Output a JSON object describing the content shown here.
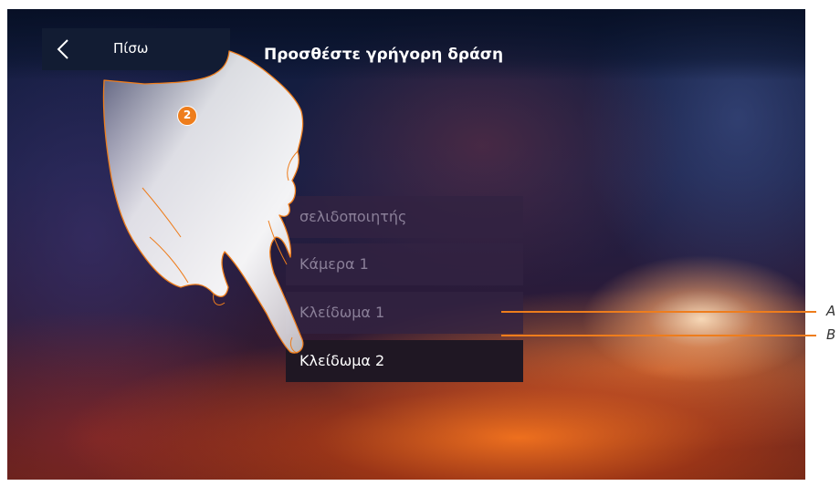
{
  "header": {
    "back_label": "Πίσω",
    "title": "Προσθέστε γρήγορη δράση"
  },
  "list": {
    "items": [
      {
        "label": "σελιδοποιητής",
        "selected": false
      },
      {
        "label": "Κάμερα 1",
        "selected": false
      },
      {
        "label": "Κλείδωμα 1",
        "selected": false
      },
      {
        "label": "Κλείδωμα 2",
        "selected": true
      }
    ]
  },
  "annotation": {
    "step": "2",
    "callout_a": "A",
    "callout_b": "B",
    "accent_color": "#ee7d1c"
  },
  "icons": {
    "back": "chevron-left-icon",
    "gesture": "pointing-hand-icon"
  }
}
